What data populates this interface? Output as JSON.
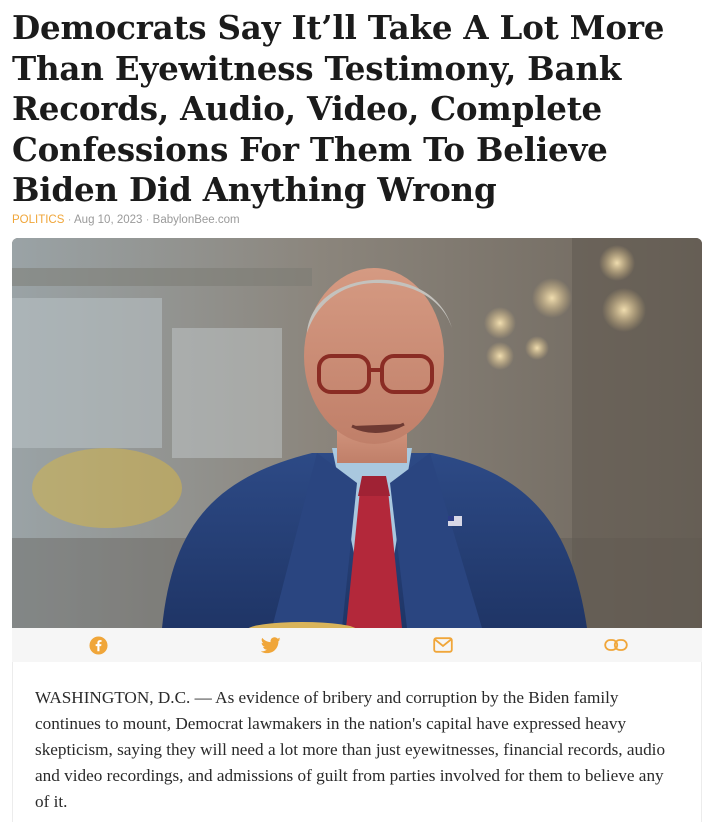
{
  "article": {
    "headline": "Democrats Say It’ll Take A Lot More Than Eyewitness Testimony, Bank Records, Audio, Video, Complete Confessions For Them To Believe Biden Did Anything Wrong",
    "category": "POLITICS",
    "separator": " · ",
    "date": "Aug 10, 2023",
    "source": "BabylonBee.com",
    "body": "WASHINGTON, D.C. — As evidence of bribery and corruption by the Biden family continues to mount, Democrat lawmakers in the nation's capital have expressed heavy skepticism, saying they will need a lot more than just eyewitnesses, financial records, audio and video recordings, and admissions of guilt from parties involved for them to believe any of it."
  },
  "share": {
    "buttons": [
      {
        "icon": "facebook-icon"
      },
      {
        "icon": "twitter-icon"
      },
      {
        "icon": "email-icon"
      },
      {
        "icon": "link-icon"
      }
    ],
    "icon_color": "#f0a63a"
  },
  "colors": {
    "accent": "#f0a63a",
    "meta_text": "#9a9a9a",
    "share_bar_bg": "#f6f6f6"
  }
}
